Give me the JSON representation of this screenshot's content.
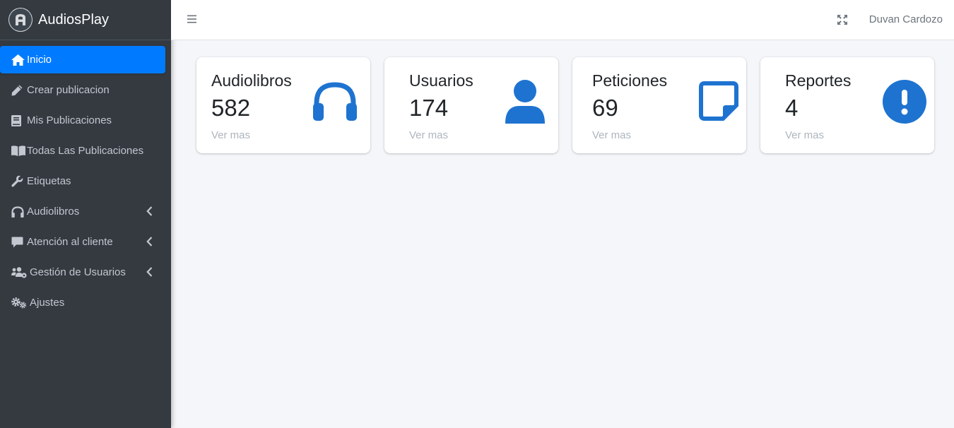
{
  "brand": {
    "name": "AudiosPlay",
    "logo_icon": "audiosplay-logo-icon"
  },
  "sidebar": {
    "items": [
      {
        "label": "Inicio",
        "icon": "home-icon",
        "active": true
      },
      {
        "label": "Crear publicacion",
        "icon": "pencil-icon"
      },
      {
        "label": "Mis Publicaciones",
        "icon": "book-icon"
      },
      {
        "label": "Todas Las Publicaciones",
        "icon": "book-open-icon"
      },
      {
        "label": "Etiquetas",
        "icon": "wrench-icon"
      },
      {
        "label": "Audiolibros",
        "icon": "headphones-icon",
        "expandable": true
      },
      {
        "label": "Atención al cliente",
        "icon": "comment-icon",
        "expandable": true
      },
      {
        "label": "Gestión de Usuarios",
        "icon": "users-cog-icon",
        "expandable": true
      },
      {
        "label": "Ajustes",
        "icon": "cogs-icon"
      }
    ]
  },
  "topbar": {
    "menu_icon": "hamburger-icon",
    "fullscreen_icon": "expand-icon",
    "user_name": "Duvan Cardozo"
  },
  "cards": [
    {
      "title": "Audiolibros",
      "count": "582",
      "link": "Ver mas",
      "icon": "headphones-icon"
    },
    {
      "title": "Usuarios",
      "count": "174",
      "link": "Ver mas",
      "icon": "user-icon"
    },
    {
      "title": "Peticiones",
      "count": "69",
      "link": "Ver mas",
      "icon": "sticky-note-icon"
    },
    {
      "title": "Reportes",
      "count": "4",
      "link": "Ver mas",
      "icon": "exclamation-circle-icon"
    }
  ],
  "colors": {
    "accent": "#007bff",
    "icon_blue": "#1e73d0",
    "sidebar_bg": "#343a40",
    "content_bg": "#f4f6f9"
  }
}
